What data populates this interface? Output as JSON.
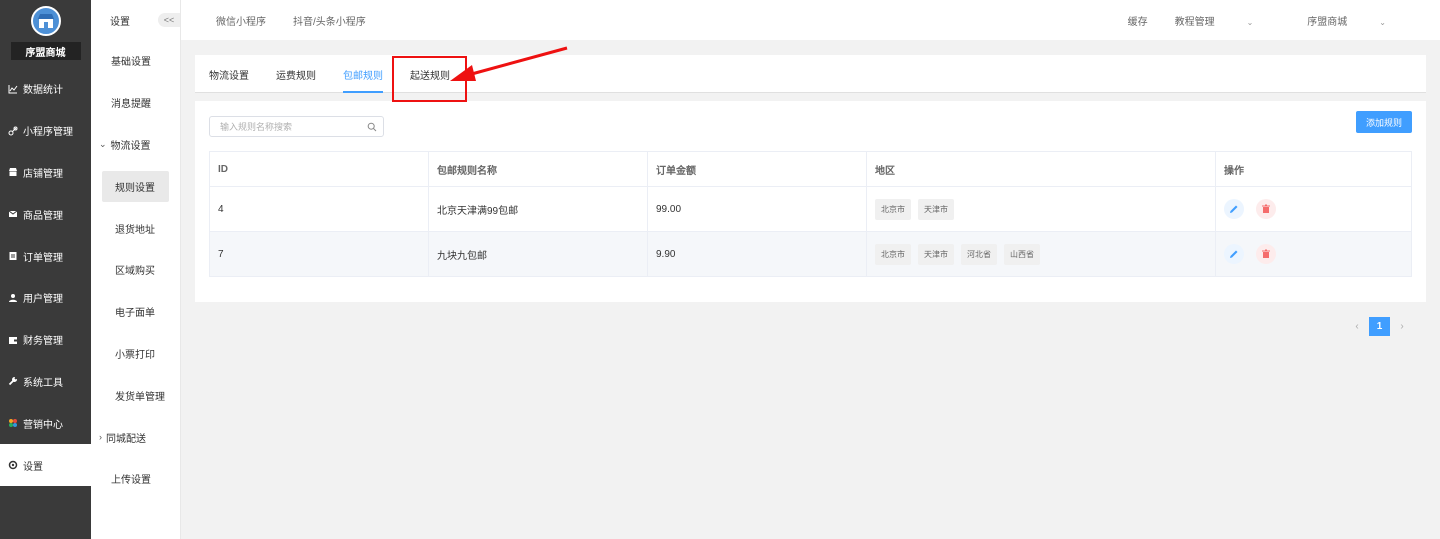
{
  "sidebar": {
    "shop_name": "序盟商城",
    "items": [
      {
        "label": "数据统计",
        "icon": "chart-icon"
      },
      {
        "label": "小程序管理",
        "icon": "link-icon"
      },
      {
        "label": "店铺管理",
        "icon": "store-icon"
      },
      {
        "label": "商品管理",
        "icon": "mail-icon"
      },
      {
        "label": "订单管理",
        "icon": "order-icon"
      },
      {
        "label": "用户管理",
        "icon": "user-icon"
      },
      {
        "label": "财务管理",
        "icon": "wallet-icon"
      },
      {
        "label": "系统工具",
        "icon": "wrench-icon"
      },
      {
        "label": "营销中心",
        "icon": "marketing-icon"
      },
      {
        "label": "设置",
        "icon": "gear-icon"
      }
    ]
  },
  "submenu": {
    "title": "设置",
    "collapse": "<<",
    "items": [
      "基础设置",
      "消息提醒",
      "物流设置",
      "规则设置",
      "退货地址",
      "区域购买",
      "电子面单",
      "小票打印",
      "发货单管理",
      "同城配送",
      "上传设置"
    ]
  },
  "topbar": {
    "links": [
      "微信小程序",
      "抖音/头条小程序"
    ],
    "right": [
      "缓存",
      "教程管理",
      "序盟商城"
    ]
  },
  "tabs": [
    "物流设置",
    "运费规则",
    "包邮规则",
    "起送规则"
  ],
  "search": {
    "placeholder": "输入规则名称搜索"
  },
  "add_button": "添加规则",
  "table": {
    "headers": [
      "ID",
      "包邮规则名称",
      "订单金额",
      "地区",
      "操作"
    ],
    "rows": [
      {
        "id": "4",
        "name": "北京天津满99包邮",
        "amount": "99.00",
        "regions": [
          "北京市",
          "天津市"
        ]
      },
      {
        "id": "7",
        "name": "九块九包邮",
        "amount": "9.90",
        "regions": [
          "北京市",
          "天津市",
          "河北省",
          "山西省"
        ]
      }
    ]
  },
  "pagination": {
    "prev": "‹",
    "current": "1",
    "next": "›"
  },
  "colors": {
    "accent": "#409eff",
    "sidebar": "#3a3a3a",
    "annotation": "#ee1111"
  }
}
